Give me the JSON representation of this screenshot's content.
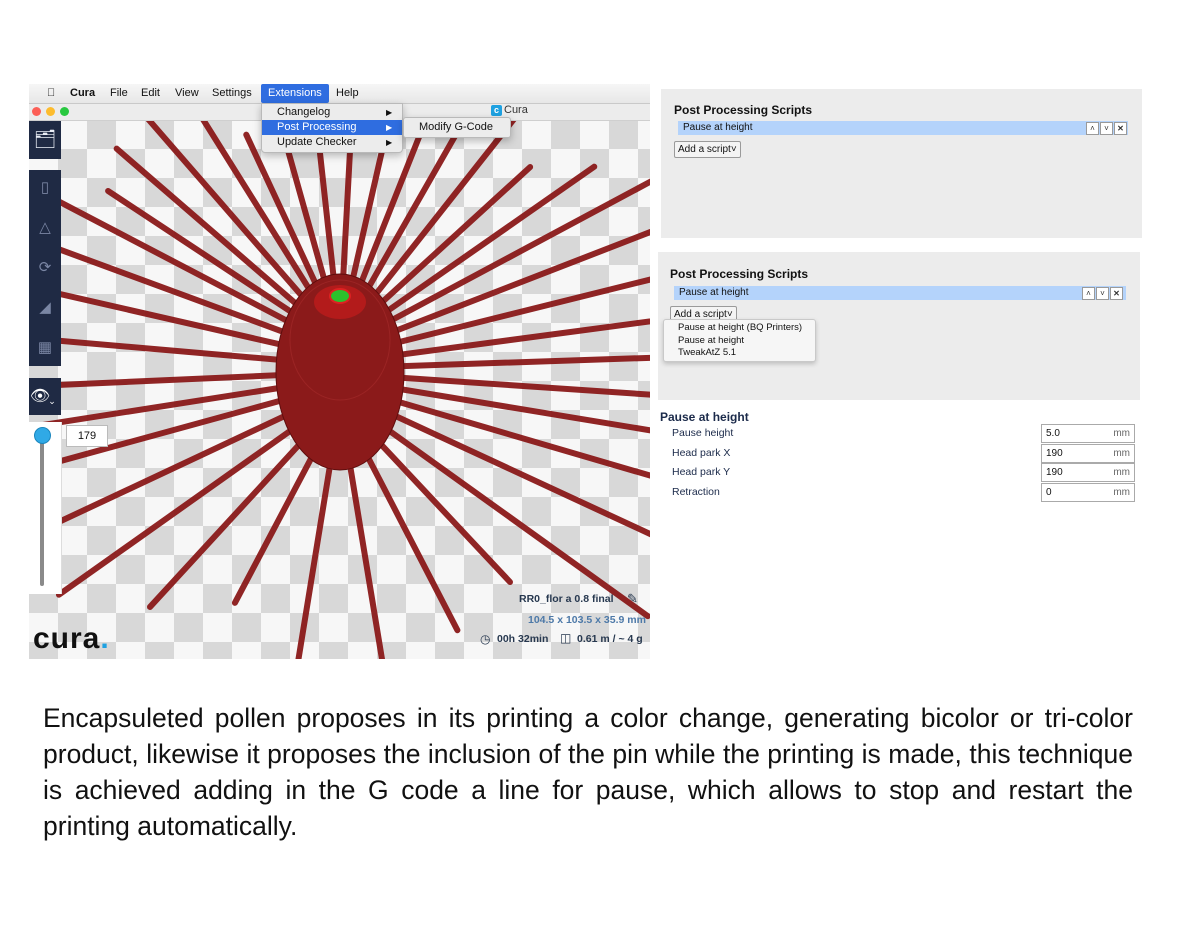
{
  "menubar": {
    "apple": "",
    "app": "Cura",
    "items": [
      "File",
      "Edit",
      "View",
      "Settings",
      "Extensions",
      "Help"
    ]
  },
  "window_title": "Cura",
  "extensions_menu": {
    "items": [
      "Changelog",
      "Post Processing",
      "Update Checker"
    ],
    "submenu_item": "Modify G-Code"
  },
  "layer_view": {
    "current_layer": "179"
  },
  "print_info": {
    "name": "RR0_flor a 0.8 final",
    "dimensions": "104.5 x 103.5 x 35.9 mm",
    "time": "00h 32min",
    "material": "0.61 m / ~ 4 g"
  },
  "logo": "cura.",
  "panel1": {
    "title": "Post Processing Scripts",
    "script": "Pause at height",
    "add_button": "Add a script"
  },
  "panel2": {
    "title": "Post Processing Scripts",
    "script": "Pause at height",
    "add_button": "Add a script",
    "dropdown": [
      "Pause at height (BQ Printers)",
      "Pause at height",
      "TweakAtZ 5.1"
    ]
  },
  "pause_settings": {
    "title": "Pause at height",
    "fields": [
      {
        "label": "Pause height",
        "value": "5.0",
        "unit": "mm"
      },
      {
        "label": "Head park X",
        "value": "190",
        "unit": "mm"
      },
      {
        "label": "Head park Y",
        "value": "190",
        "unit": "mm"
      },
      {
        "label": "Retraction",
        "value": "0",
        "unit": "mm"
      }
    ]
  },
  "caption": "Encapsuleted pollen proposes in its printing a color change, generating bicolor or tri-color product, likewise it proposes the inclusion of the pin while the printing is made, this technique is  achieved adding in the G code a line for pause, which allows to stop and restart the printing automatically.",
  "colors": {
    "menu_highlight": "#2f6de0",
    "model_red": "#8b1a1a",
    "toolbar_navy": "#1f2a44",
    "slider_blue": "#30a9e6",
    "script_row": "#b4d3fb"
  }
}
